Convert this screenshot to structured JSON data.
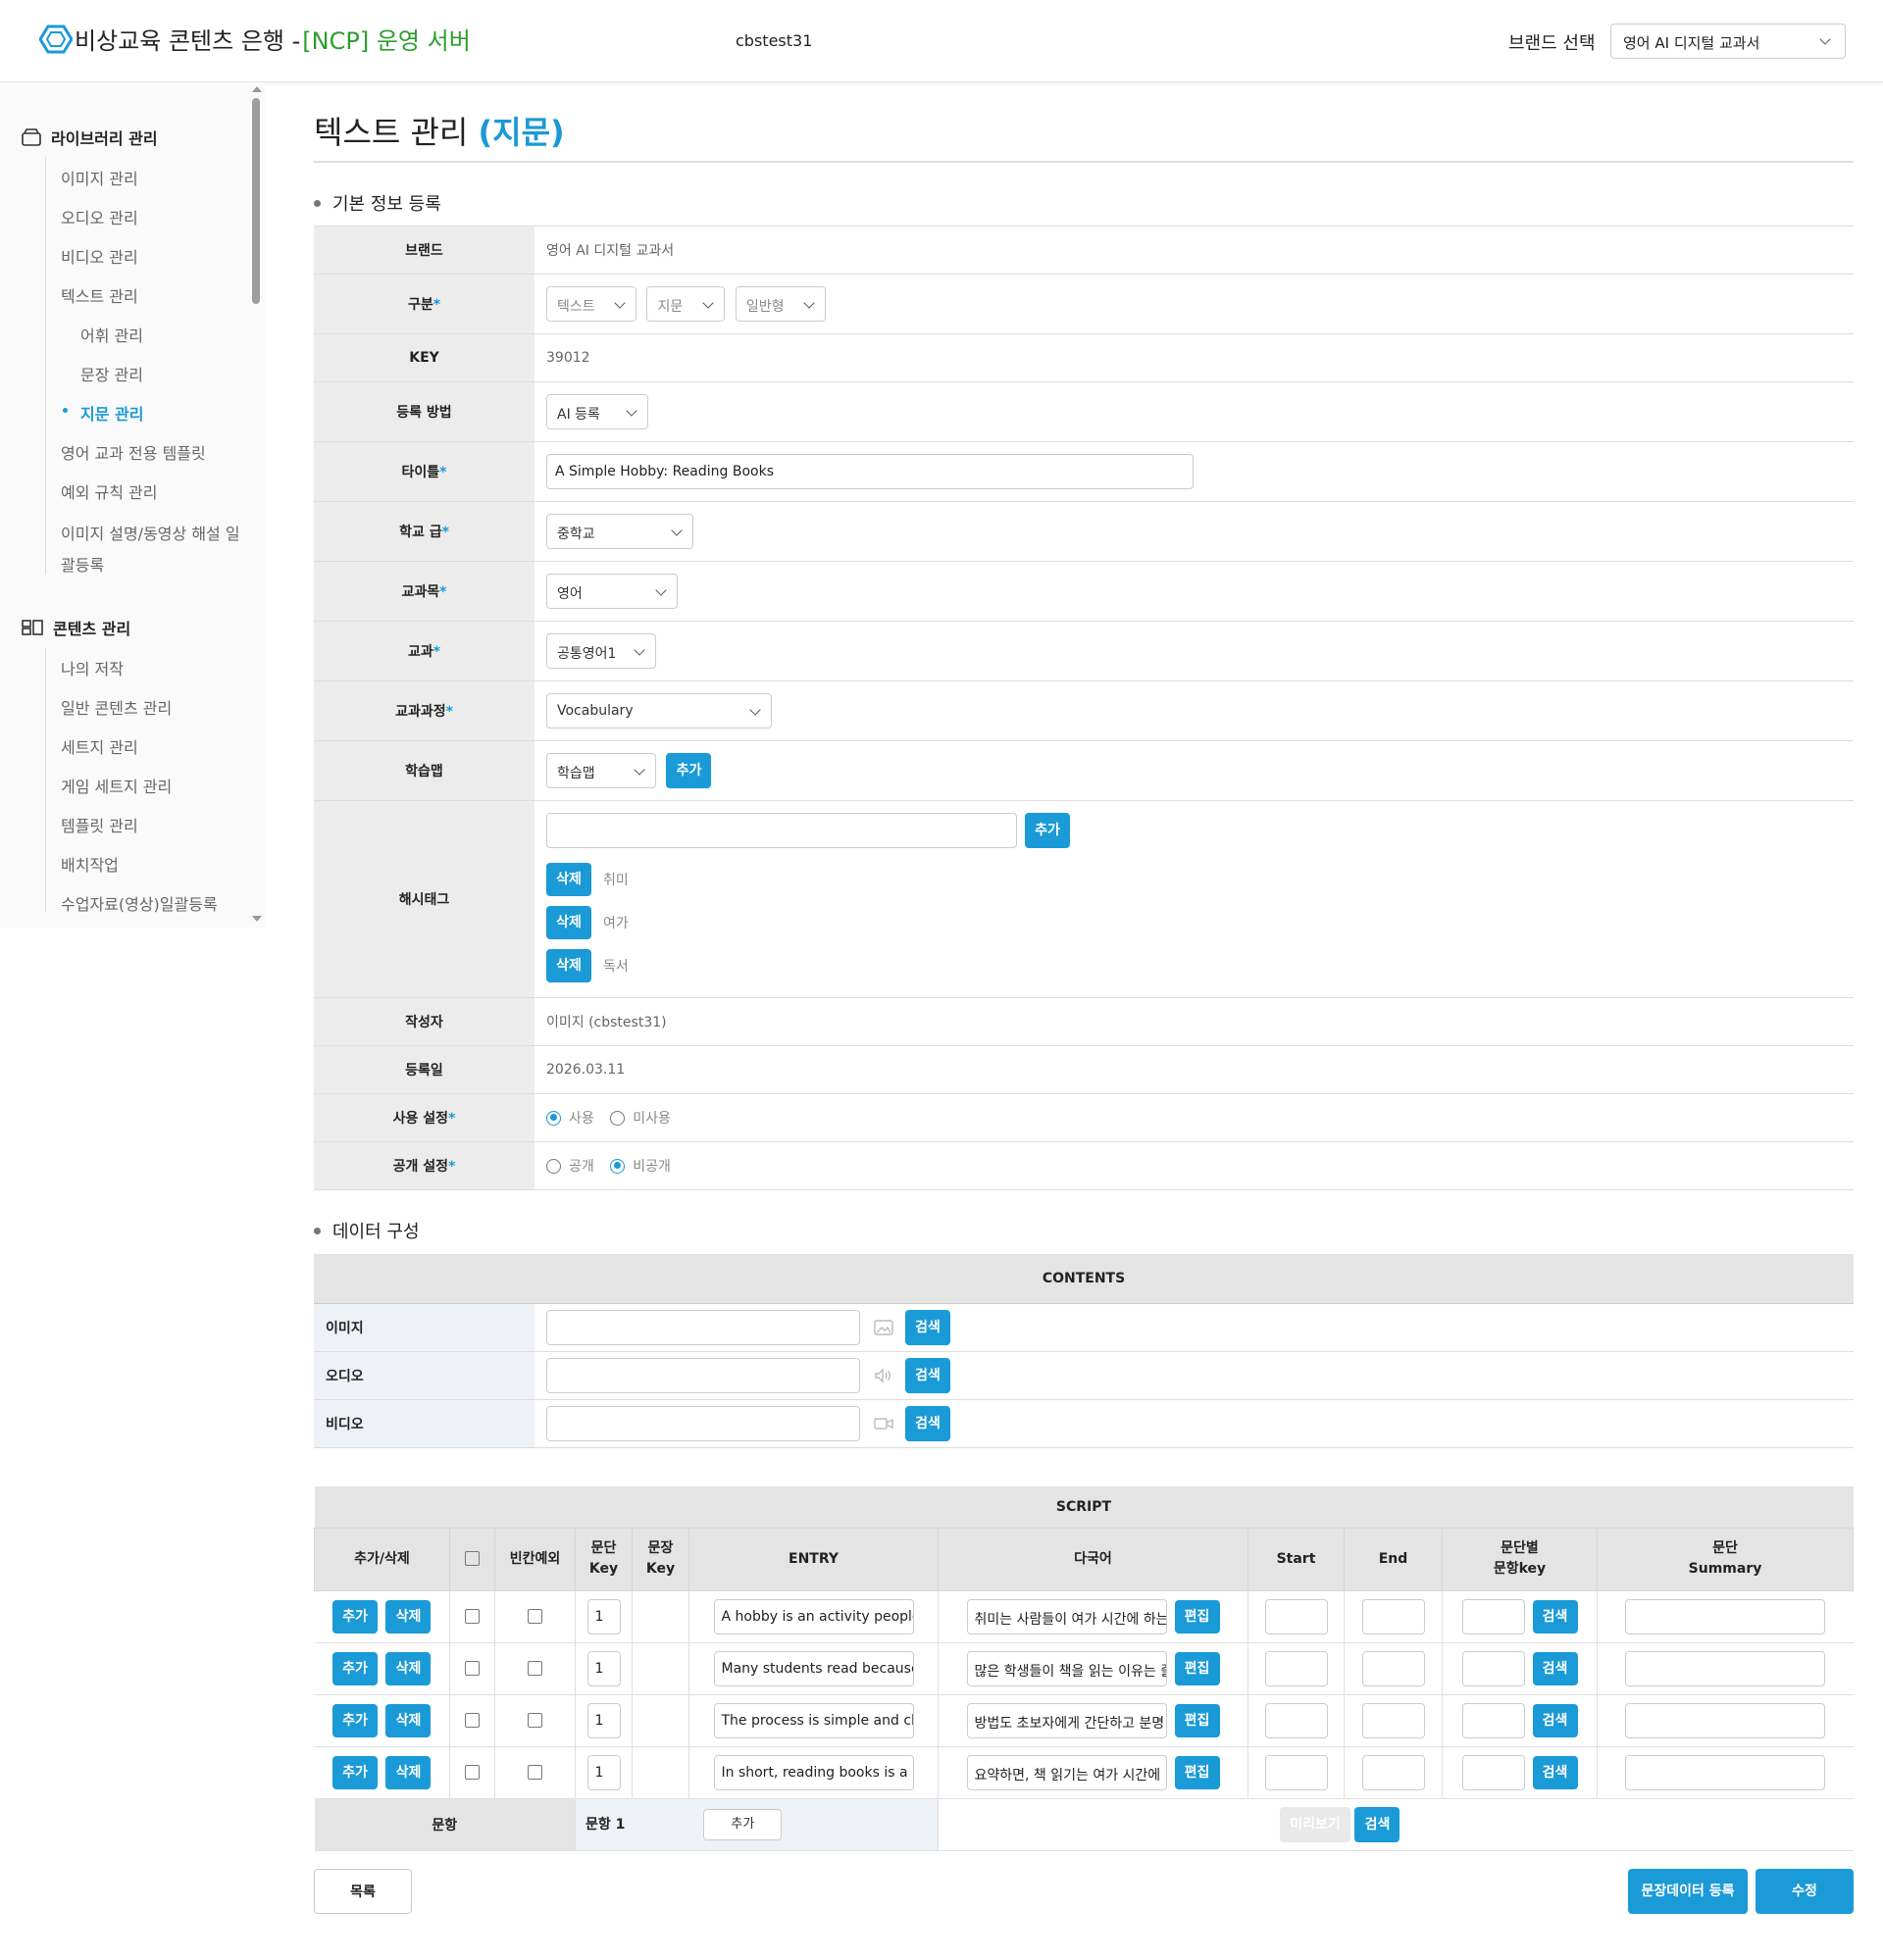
{
  "header": {
    "logo_text": "비상교육 콘텐츠 은행 - ",
    "logo_server": "[NCP] 운영 서버",
    "user_id": "cbstest31",
    "brand_label": "브랜드 선택",
    "brand_value": "영어 AI 디지털 교과서"
  },
  "sidebar": {
    "library_group": "라이브러리 관리",
    "library_items": [
      "이미지 관리",
      "오디오 관리",
      "비디오 관리",
      "텍스트 관리",
      "어휘 관리",
      "문장 관리",
      "지문 관리",
      "영어 교과 전용 템플릿",
      "예외 규칙 관리",
      "이미지 설명/동영상 해설 일",
      "괄등록"
    ],
    "content_group": "콘텐츠 관리",
    "content_items": [
      "나의 저작",
      "일반 콘텐츠 관리",
      "세트지 관리",
      "게임 세트지 관리",
      "템플릿 관리",
      "배치작업",
      "수업자료(영상)일괄등록"
    ]
  },
  "page": {
    "title_main": "텍스트 관리 ",
    "title_hl": "(지문)"
  },
  "basic_info": {
    "section_title": "기본 정보 등록",
    "labels": {
      "brand": "브랜드",
      "category": "구분",
      "key": "KEY",
      "reg_method": "등록 방법",
      "title": "타이틀",
      "school_level": "학교 급",
      "subject": "교과목",
      "course": "교과",
      "curriculum": "교과과정",
      "learning_map": "학습맵",
      "hashtag": "해시태그",
      "author": "작성자",
      "reg_date": "등록일",
      "use_setting": "사용 설정",
      "public_setting": "공개 설정"
    },
    "required_mark": "*",
    "brand_value": "영어 AI 디지털 교과서",
    "category_values": [
      "텍스트",
      "지문",
      "일반형"
    ],
    "key_value": "39012",
    "reg_method_value": "AI 등록",
    "title_value": "A Simple Hobby: Reading Books",
    "school_level_value": "중학교",
    "subject_value": "영어",
    "course_value": "공통영어1",
    "curriculum_value": "Vocabulary",
    "learning_map_value": "학습맵",
    "add_label": "추가",
    "delete_label": "삭제",
    "hashtags": [
      "취미",
      "여가",
      "독서"
    ],
    "author_value": "이미지 (cbstest31)",
    "reg_date_value": "2026.03.11",
    "use_options": [
      "사용",
      "미사용"
    ],
    "use_selected": "사용",
    "public_options": [
      "공개",
      "비공개"
    ],
    "public_selected": "비공개"
  },
  "data_config": {
    "section_title": "데이터 구성",
    "contents_header": "CONTENTS",
    "media_rows": [
      {
        "label": "이미지",
        "icon": "image-icon"
      },
      {
        "label": "오디오",
        "icon": "speaker-icon"
      },
      {
        "label": "비디오",
        "icon": "video-camera-icon"
      }
    ],
    "search_label": "검색"
  },
  "script": {
    "header": "SCRIPT",
    "columns": {
      "add_delete": "추가/삭제",
      "blank_exception": "빈칸예외",
      "para_key_1": "문단",
      "para_key_2": "Key",
      "sent_key_1": "문장",
      "sent_key_2": "Key",
      "entry": "ENTRY",
      "multilang": "다국어",
      "start": "Start",
      "end": "End",
      "para_q_1": "문단별",
      "para_q_2": "문항key",
      "summary_1": "문단",
      "summary_2": "Summary"
    },
    "add_label": "추가",
    "delete_label": "삭제",
    "edit_label": "편집",
    "search_label": "검색",
    "rows": [
      {
        "para_key": "1",
        "entry": "A hobby is an activity people",
        "multilang": "취미는 사람들이 여가 시간에 하는"
      },
      {
        "para_key": "1",
        "entry": "Many students read because",
        "multilang": "많은 학생들이 책을 읽는 이유는 즐"
      },
      {
        "para_key": "1",
        "entry": "The process is simple and cle",
        "multilang": "방법도 초보자에게 간단하고 분명"
      },
      {
        "para_key": "1",
        "entry": "In short, reading books is a hi",
        "multilang": "요약하면, 책 읽기는 여가 시간에"
      }
    ],
    "question_label": "문항",
    "question_name": "문항 1",
    "question_add": "추가",
    "preview_label": "미리보기",
    "question_search": "검색"
  },
  "footer": {
    "list_label": "목록",
    "sentence_data_label": "문장데이터 등록",
    "edit_label": "수정"
  },
  "colors": {
    "accent": "#1a9ad6",
    "server_green": "#2e9e2e"
  }
}
